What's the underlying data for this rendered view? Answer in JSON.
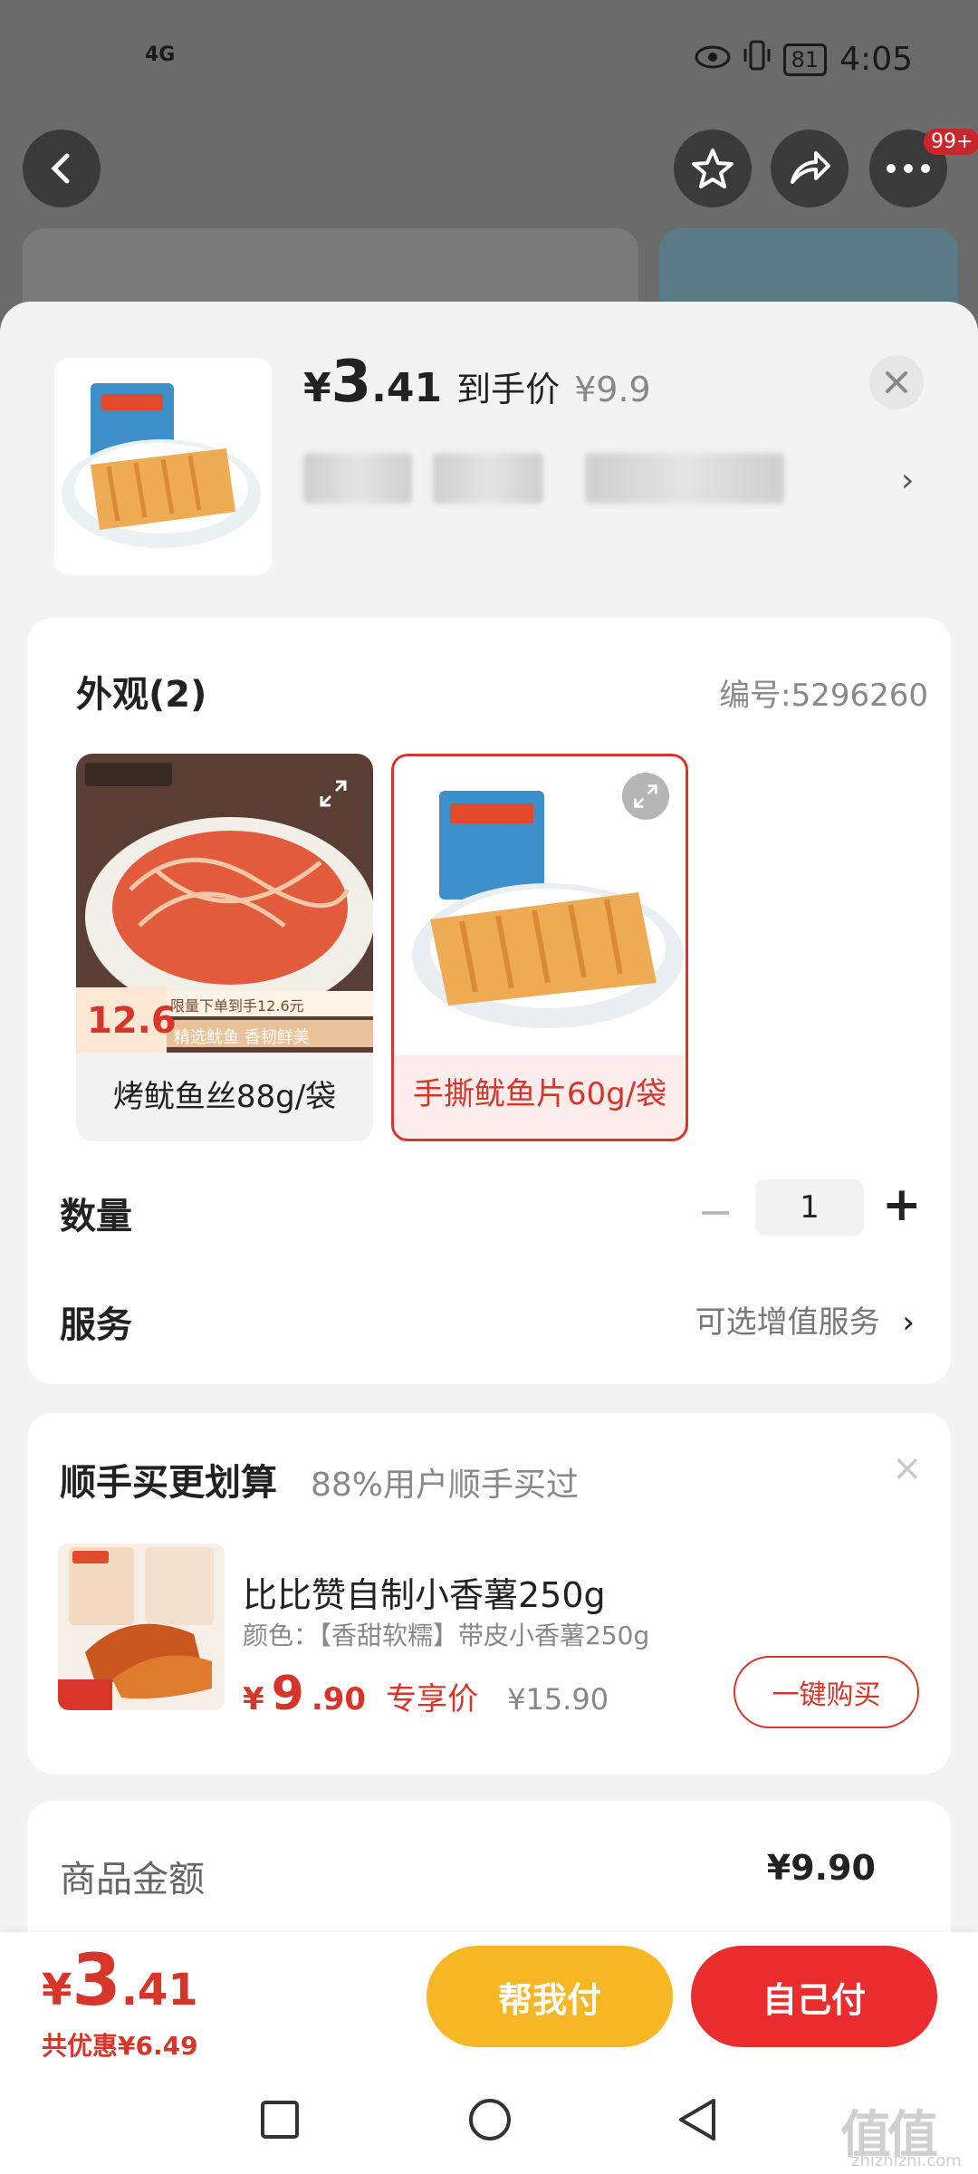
{
  "status": {
    "network": "4G",
    "battery": "81",
    "time": "4:05"
  },
  "nav": {
    "more_badge": "99+"
  },
  "product": {
    "price_symbol": "¥",
    "price_int": "3",
    "price_dec": ".41",
    "price_tag": "到手价",
    "original_price": "¥9.9"
  },
  "appearance": {
    "label": "外观(2)",
    "code": "编号:5296260",
    "variants": [
      {
        "label": "烤鱿鱼丝88g/袋",
        "selected": false,
        "promo_price": "12.6",
        "promo_tag": "限量下单到手12.6元",
        "promo_line": "精选鱿鱼 香韧鲜美"
      },
      {
        "label": "手撕鱿鱼片60g/袋",
        "selected": true
      }
    ]
  },
  "quantity": {
    "label": "数量",
    "minus": "−",
    "value": "1",
    "plus": "+"
  },
  "service": {
    "label": "服务",
    "value": "可选增值服务",
    "chevron": "›"
  },
  "upsell": {
    "title": "顺手买更划算",
    "subtitle": "88%用户顺手买过",
    "close": "×",
    "item_name": "比比赞自制小香薯250g",
    "item_attr": "颜色：【香甜软糯】带皮小香薯250g",
    "price_symbol": "¥",
    "price_int": "9",
    "price_dec": ".90",
    "price_tag": "专享价",
    "original_price": "¥15.90",
    "buy_label": "一键购买"
  },
  "summary": {
    "label": "商品金额",
    "value": "¥9.90"
  },
  "footer": {
    "price_symbol": "¥",
    "price_int": "3",
    "price_dec": ".41",
    "discount": "共优惠¥6.49",
    "help_pay_label": "帮我付",
    "self_pay_label": "自己付"
  },
  "watermark": {
    "text": "值值值",
    "sub": "zhizhizhi.com"
  },
  "colors": {
    "accent": "#d8352a",
    "help_pay": "#f7b724",
    "self_pay": "#ea2c2f"
  }
}
